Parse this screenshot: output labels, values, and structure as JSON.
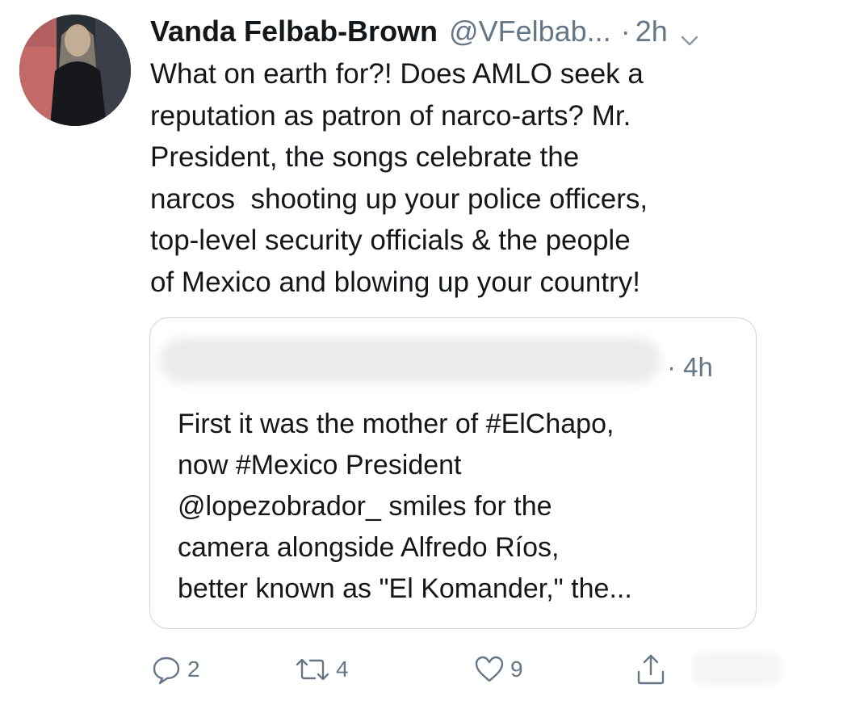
{
  "tweet": {
    "author": {
      "name": "Vanda Felbab-Brown",
      "handle": "@VFelbab...",
      "time": "2h",
      "separator": "·"
    },
    "text_lines": [
      "What on earth for?! Does AMLO seek a",
      "reputation as patron of narco-arts? Mr.",
      "President, the songs celebrate the",
      "narcos  shooting up your police officers,",
      "top-level security officials & the people",
      "of Mexico and blowing up your country!"
    ],
    "quoted": {
      "time": "· 4h",
      "text_lines": [
        "First it was the mother of #ElChapo,",
        "now #Mexico President",
        "@lopezobrador_ smiles for the",
        "camera alongside Alfredo Ríos,",
        "better known as \"El Komander,\" the..."
      ]
    },
    "actions": {
      "replies": "2",
      "retweets": "4",
      "likes": "9"
    }
  },
  "icons": {
    "reply": "speech-bubble-icon",
    "retweet": "retweet-arrows-icon",
    "like": "heart-icon",
    "share": "share-upload-icon",
    "menu": "chevron-down-icon"
  },
  "colors": {
    "text": "#14171a",
    "secondary": "#657786",
    "border": "#ccd6dd"
  }
}
